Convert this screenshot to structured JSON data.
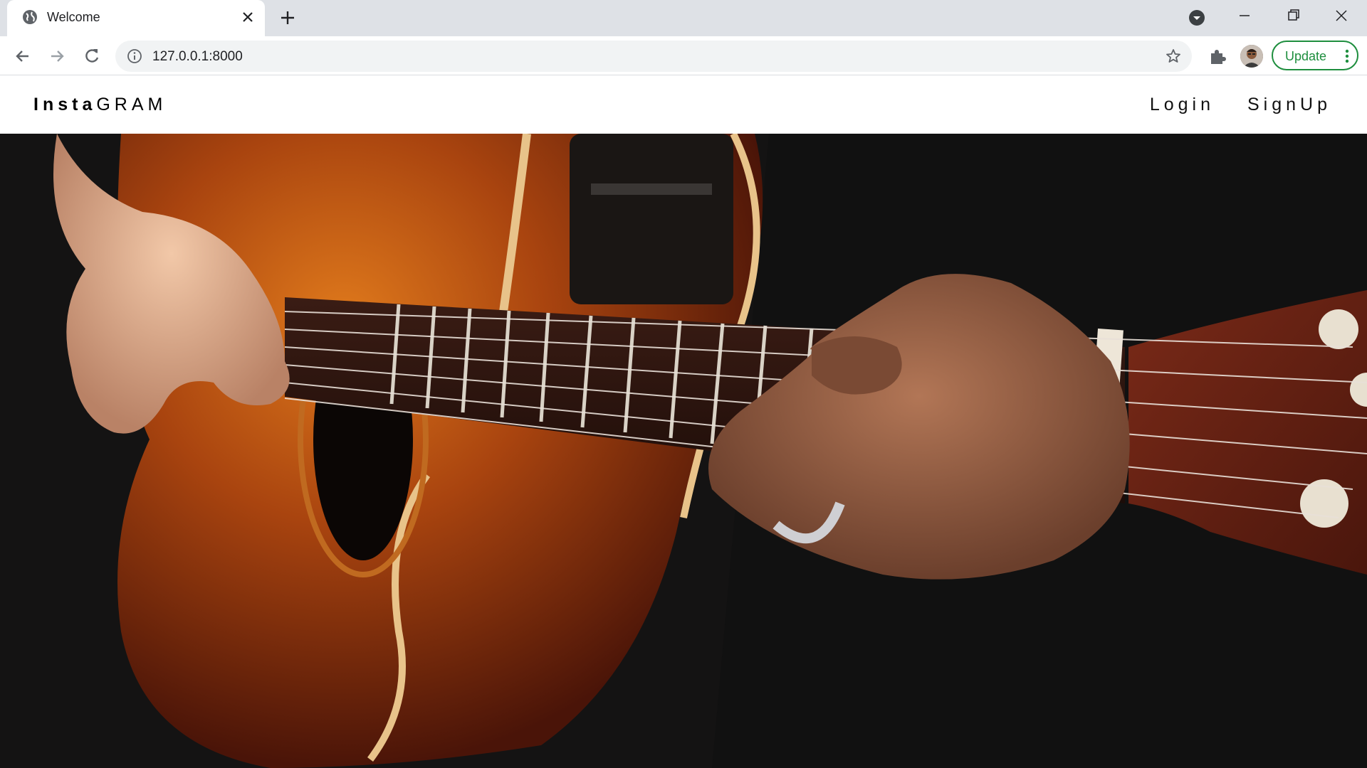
{
  "browser": {
    "tab_title": "Welcome",
    "url": "127.0.0.1:8000",
    "update_label": "Update"
  },
  "site": {
    "brand_bold": "Insta",
    "brand_rest": "GRAM",
    "nav": [
      {
        "label": "Login"
      },
      {
        "label": "SignUp"
      }
    ]
  },
  "hero": {
    "image_subject": "hands playing acoustic guitar"
  }
}
